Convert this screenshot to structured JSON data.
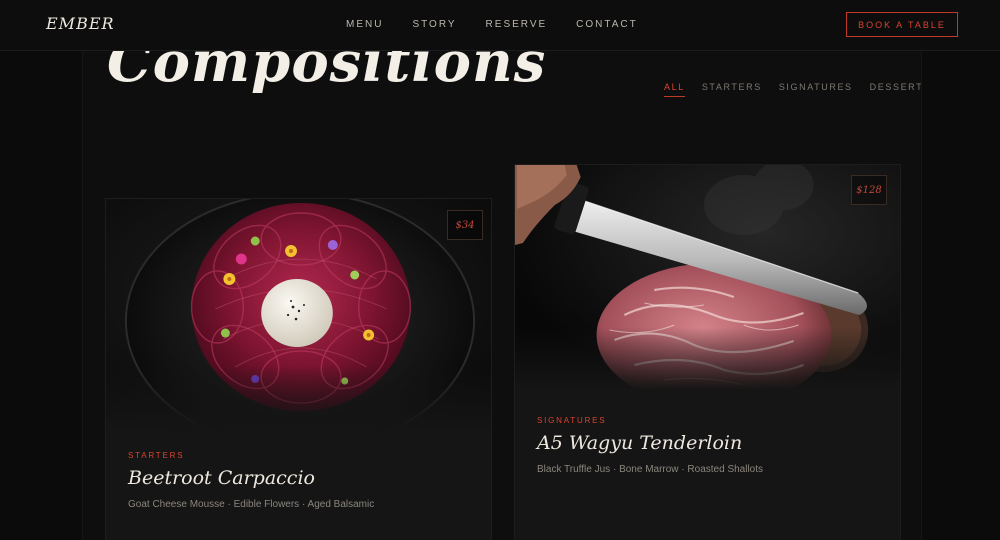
{
  "brand": "EMBER",
  "nav": {
    "links": [
      "MENU",
      "STORY",
      "RESERVE",
      "CONTACT"
    ],
    "cta": "BOOK A TABLE"
  },
  "section": {
    "heading": "Compositions",
    "filters": [
      "ALL",
      "STARTERS",
      "SIGNATURES",
      "DESSERTS"
    ],
    "active_filter": "ALL"
  },
  "dishes": [
    {
      "price": "$34",
      "category": "STARTERS",
      "name": "Beetroot Carpaccio",
      "description": "Goat Cheese Mousse · Edible Flowers · Aged Balsamic",
      "image_icon": "beetroot-plate-icon"
    },
    {
      "price": "$128",
      "category": "SIGNATURES",
      "name": "A5 Wagyu Tenderloin",
      "description": "Black Truffle Jus · Bone Marrow · Roasted Shallots",
      "image_icon": "wagyu-knife-icon"
    }
  ],
  "colors": {
    "accent": "#d9432f",
    "background": "#0b0b0b",
    "card": "#151515",
    "text": "#eee8df"
  }
}
